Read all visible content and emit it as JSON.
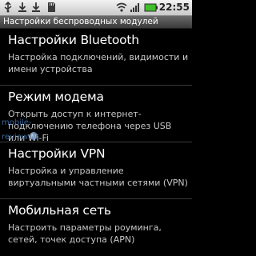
{
  "status_bar": {
    "time": "22:55",
    "icons": [
      "usb-icon",
      "download-icon",
      "download-icon",
      "sd-card-icon",
      "wifi-icon",
      "signal-icon",
      "battery-icon"
    ]
  },
  "title": "Настройки беспроводных модулей",
  "items": [
    {
      "title": "Настройки Bluetooth",
      "summary": "Настройка подключений, видимости и имени устройства"
    },
    {
      "title": "Режим модема",
      "summary": "Открыть доступ к интернет-подключению телефона через USB или Wi-Fi"
    },
    {
      "title": "Настройки VPN",
      "summary": "Настройка и управление виртуальными частными сетями (VPN)"
    },
    {
      "title": "Мобильная сеть",
      "summary": "Настроить параметры роуминга, сетей, точек доступа (APN)"
    }
  ],
  "colors": {
    "background": "#000000",
    "title_bar": "#4a4a4a",
    "battery": "#3fbf2a"
  },
  "watermark": "mobile-review"
}
